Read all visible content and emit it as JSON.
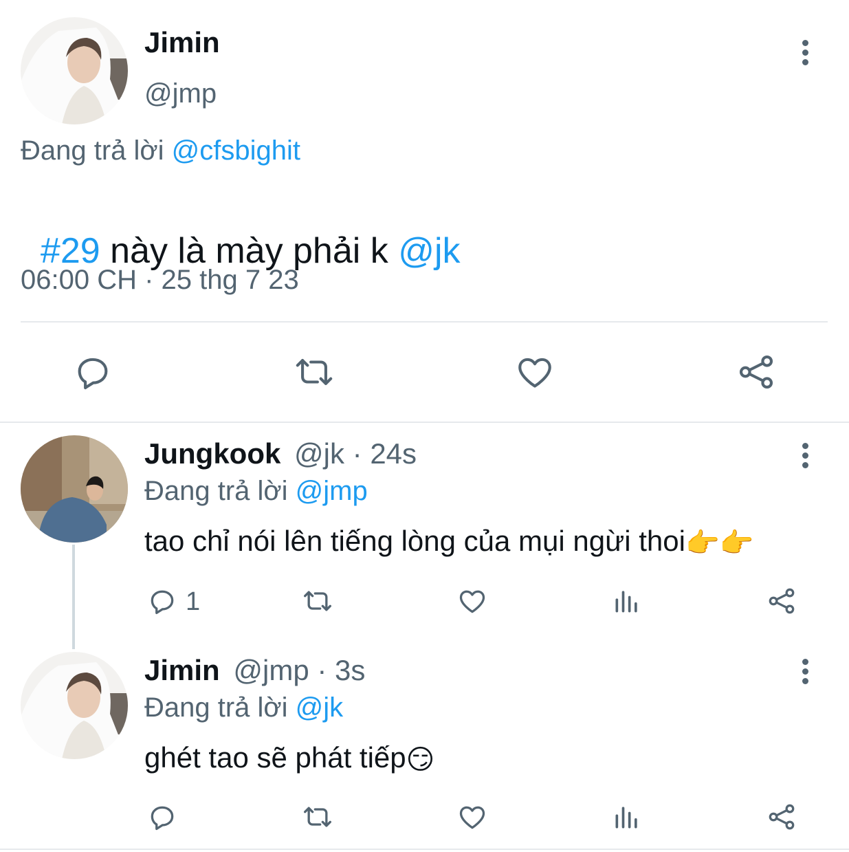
{
  "main_tweet": {
    "author_name": "Jimin",
    "author_handle": "@jmp",
    "reply_prefix": "Đang trả lời",
    "reply_to": "@cfsbighit",
    "text_hashtag": "#29",
    "text_body": " này là mày phải k ",
    "text_mention": "@jk",
    "timestamp": "06:00 CH · 25 thg 7 23",
    "actions": [
      "reply-icon",
      "retweet-icon",
      "like-icon",
      "share-icon"
    ]
  },
  "replies": [
    {
      "author_name": "Jungkook",
      "author_handle": "@jk",
      "time": "· 24s",
      "reply_prefix": "Đang trả lời",
      "reply_to": "@jmp",
      "text": "tao chỉ nói lên tiếng lòng của mụi ngừi thoi",
      "emoji": "👉👉",
      "reply_count": "1"
    },
    {
      "author_name": "Jimin",
      "author_handle": "@jmp",
      "time": "· 3s",
      "reply_prefix": "Đang trả lời",
      "reply_to": "@jk",
      "text": "ghét tao sẽ phát tiếp",
      "emoji": "😏",
      "reply_count": ""
    }
  ],
  "colors": {
    "accent": "#1d9bf0",
    "secondary_text": "#536471",
    "separator": "#e6e9ec"
  }
}
